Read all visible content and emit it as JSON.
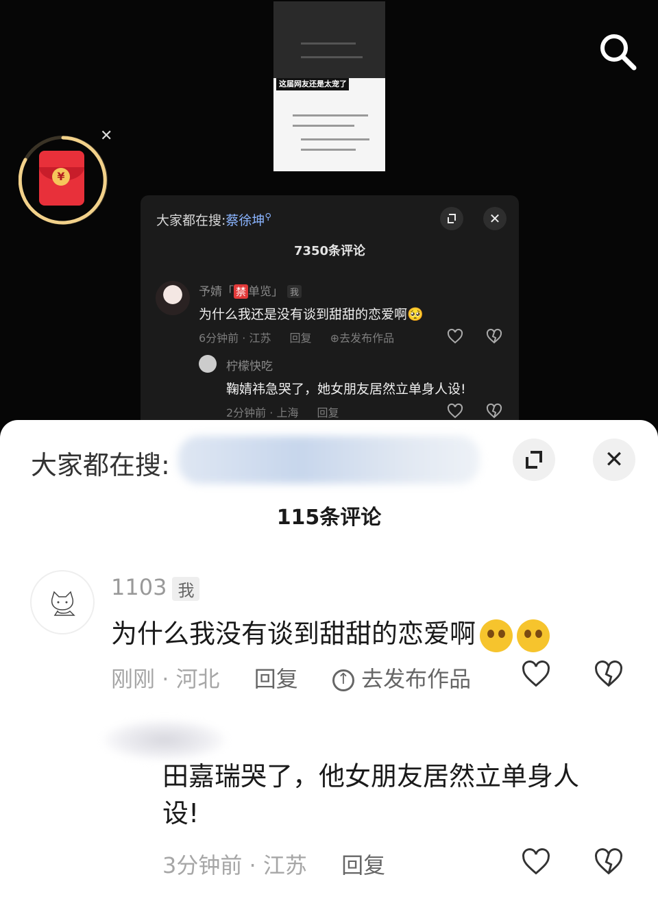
{
  "thumbnail": {
    "banner": "这届网友还是太宠了"
  },
  "dark_panel": {
    "search_prefix": "大家都在搜:",
    "search_term": "蔡徐坤",
    "count": "7350条评论",
    "comment": {
      "user_pre": "予婧「",
      "user_ban": "禁",
      "user_post": "单览」",
      "me_tag": "我",
      "text": "为什么我还是没有谈到甜甜的恋爱啊🥺",
      "time_location": "6分钟前 · 江苏",
      "reply": "回复",
      "post": "去发布作品"
    },
    "reply": {
      "user": "柠檬快吃",
      "text": "鞠婧祎急哭了，她女朋友居然立单身人设!",
      "time_location": "2分钟前 · 上海",
      "reply": "回复"
    }
  },
  "sheet": {
    "search_prefix": "大家都在搜:",
    "count": "115条评论",
    "comment": {
      "user": "1103",
      "me_tag": "我",
      "text": "为什么我没有谈到甜甜的恋爱啊",
      "time": "刚刚",
      "location": "河北",
      "reply": "回复",
      "post": "去发布作品"
    },
    "reply": {
      "text": "田嘉瑞哭了，他女朋友居然立单身人设!",
      "time": "3分钟前",
      "location": "江苏",
      "reply": "回复"
    }
  },
  "colors": {
    "accent_link": "#8ab4ff",
    "red_packet": "#e8303a",
    "ring": "#f2d18a"
  }
}
